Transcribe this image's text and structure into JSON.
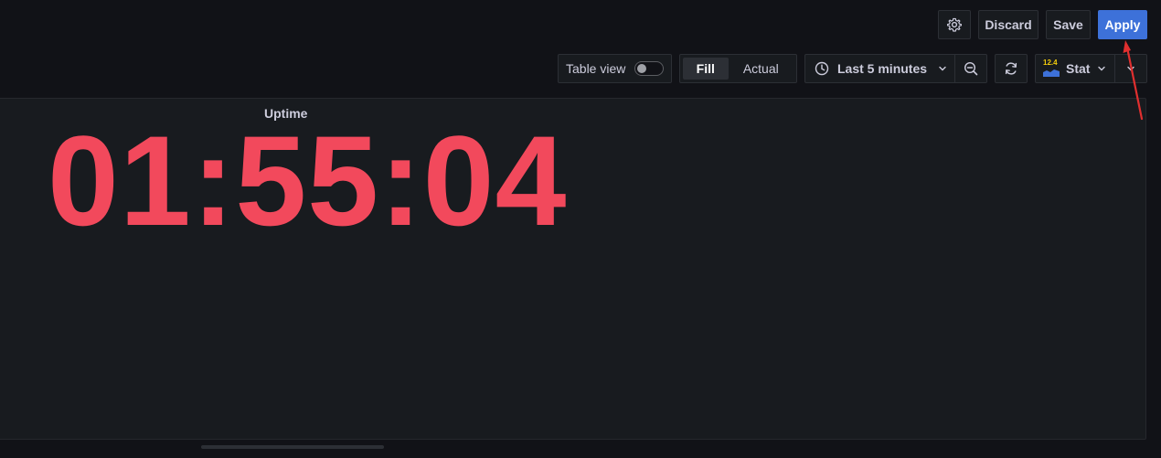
{
  "header": {
    "discard_label": "Discard",
    "save_label": "Save",
    "apply_label": "Apply"
  },
  "toolbar": {
    "table_view_label": "Table view",
    "table_view_enabled": false,
    "fill_label": "Fill",
    "actual_label": "Actual",
    "fill_mode_selected": "Fill",
    "time_range_label": "Last 5 minutes",
    "viz_label": "Stat",
    "viz_icon_text": "12.4"
  },
  "panel": {
    "title": "Uptime",
    "value": "01:55:04"
  },
  "colors": {
    "accent": "#3d71d9",
    "stat_value": "#f2495c",
    "annotation_arrow": "#e02f2f",
    "background": "#111217",
    "panel_background": "#181b1f"
  },
  "icons": {
    "settings": "gear-icon",
    "time": "clock-icon",
    "zoom_out": "zoom-out-icon",
    "refresh": "refresh-icon",
    "chevron": "chevron-down-icon"
  }
}
